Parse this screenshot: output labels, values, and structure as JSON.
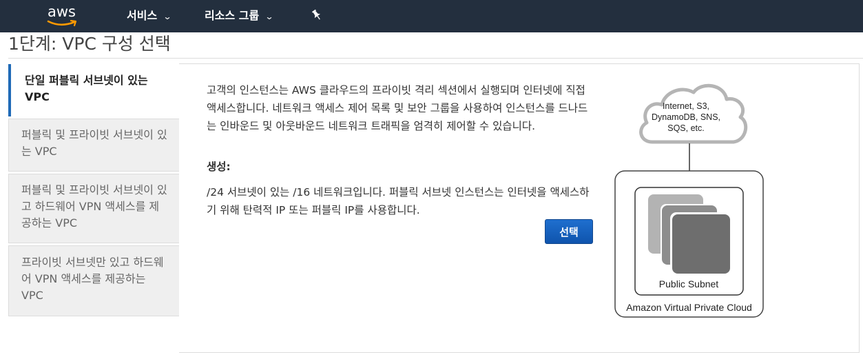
{
  "topbar": {
    "logo_text": "aws",
    "services_label": "서비스",
    "resource_groups_label": "리소스 그룹",
    "caret": "⌄",
    "pin_icon": "pushpin-icon"
  },
  "page": {
    "title": "1단계: VPC 구성 선택"
  },
  "tabs": [
    {
      "label": "단일 퍼블릭 서브넷이 있는 VPC",
      "active": true
    },
    {
      "label": "퍼블릭 및 프라이빗 서브넷이 있는 VPC",
      "active": false
    },
    {
      "label": "퍼블릭 및 프라이빗 서브넷이 있고 하드웨어 VPN 액세스를 제공하는 VPC",
      "active": false
    },
    {
      "label": "프라이빗 서브넷만 있고 하드웨어 VPN 액세스를 제공하는 VPC",
      "active": false
    }
  ],
  "content": {
    "description": "고객의 인스턴스는 AWS 클라우드의 프라이빗 격리 섹션에서 실행되며 인터넷에 직접 액세스합니다. 네트워크 액세스 제어 목록 및 보안 그룹을 사용하여 인스턴스를 드나드는 인바운드 및 아웃바운드 네트워크 트래픽을 엄격히 제어할 수 있습니다.",
    "create_label": "생성:",
    "create_text": "/24 서브넷이 있는 /16 네트워크입니다. 퍼블릭 서브넷 인스턴스는 인터넷을 액세스하기 위해 탄력적 IP 또는 퍼블릭 IP를 사용합니다.",
    "select_button": "선택"
  },
  "diagram": {
    "cloud_line1": "Internet, S3,",
    "cloud_line2": "DynamoDB, SNS,",
    "cloud_line3": "SQS, etc.",
    "subnet_label": "Public Subnet",
    "vpc_label": "Amazon Virtual Private Cloud"
  },
  "colors": {
    "topbar_bg": "#232f3e",
    "accent": "#1f6ab7",
    "button_bg": "#1a63c0",
    "logo_smile": "#ff9900"
  }
}
